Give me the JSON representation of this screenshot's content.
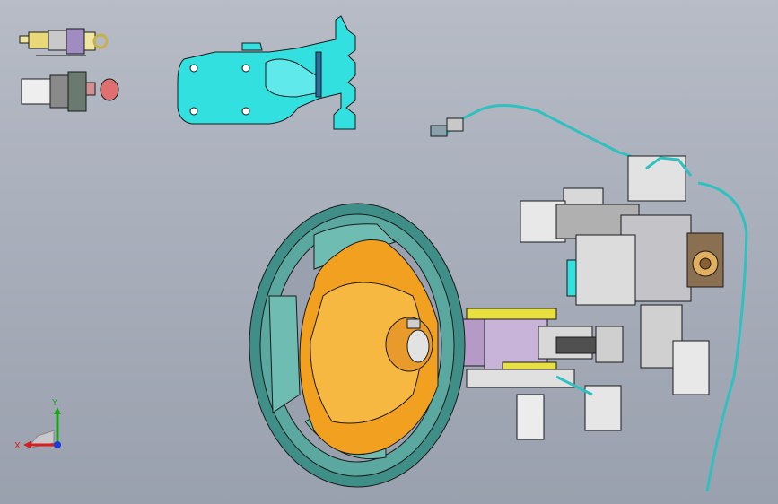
{
  "viewport": {
    "background_top": "#b7bcc6",
    "background_bottom": "#9aa1ae"
  },
  "triad": {
    "x_label": "X",
    "y_label": "Y",
    "x_color": "#d81e1e",
    "y_color": "#1fa31f",
    "z_color": "#1e3ad8"
  },
  "colors": {
    "bracket": "#33e0e0",
    "wheel_rim": "#3f8f88",
    "airbag": "#f2a020",
    "column_purple": "#b59ac8",
    "column_yellow": "#e8e040",
    "cable": "#2fc0c0",
    "edge": "#1a1a1a"
  },
  "parts": {
    "bracket": "bracket-part",
    "steering_wheel": "steering-wheel-part",
    "column": "steering-column-part",
    "switch_small_top": "switch-part-1",
    "switch_small_bottom": "switch-part-2",
    "cable": "cable-part"
  }
}
